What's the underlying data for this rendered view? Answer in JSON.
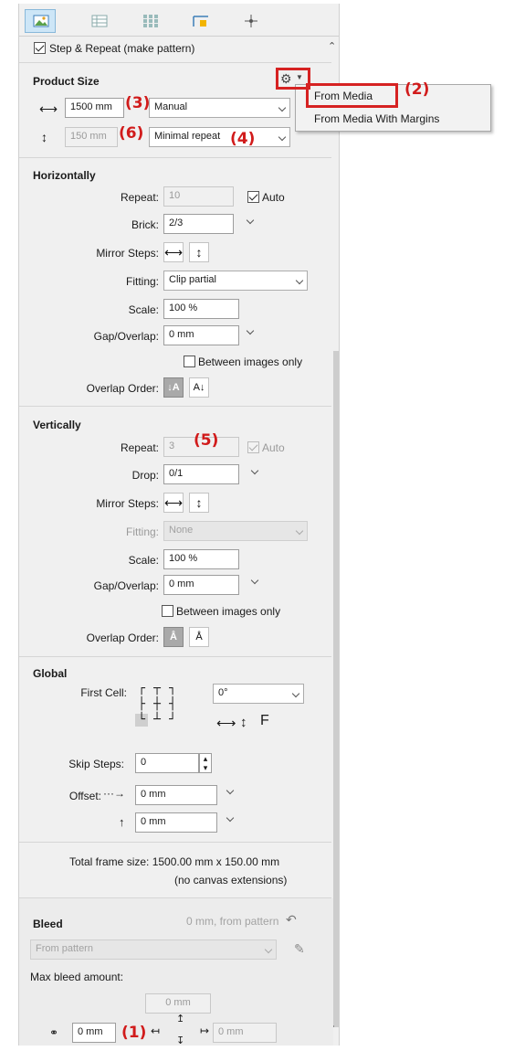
{
  "toolbar": {
    "tabs": [
      {
        "icon": "image-layout-icon",
        "active": true
      },
      {
        "icon": "table-grid-icon",
        "active": false
      },
      {
        "icon": "tile-grid-icon",
        "active": false
      },
      {
        "icon": "step-repeat-icon",
        "active": false
      },
      {
        "icon": "crosshair-icon",
        "active": false
      }
    ]
  },
  "step_repeat": {
    "label": "Step & Repeat (make pattern)",
    "checked": true
  },
  "product_size": {
    "title": "Product Size",
    "width_value": "1500 mm",
    "width_mode": "Manual",
    "height_value": "150 mm",
    "height_mode": "Minimal repeat"
  },
  "menu": {
    "items": [
      "From Media",
      "From Media With Margins"
    ]
  },
  "annotations": [
    "(1)",
    "(2)",
    "(3)",
    "(4)",
    "(5)",
    "(6)"
  ],
  "horizontally": {
    "title": "Horizontally",
    "repeat_label": "Repeat:",
    "repeat_value": "10",
    "auto_label": "Auto",
    "brick_label": "Brick:",
    "brick_value": "2/3",
    "mirror_label": "Mirror Steps:",
    "fitting_label": "Fitting:",
    "fitting_value": "Clip partial",
    "scale_label": "Scale:",
    "scale_value": "100 %",
    "gap_label": "Gap/Overlap:",
    "gap_value": "0 mm",
    "between_label": "Between images only",
    "overlap_label": "Overlap Order:",
    "order_a": "↓A",
    "order_b": "A↓"
  },
  "vertically": {
    "title": "Vertically",
    "repeat_label": "Repeat:",
    "repeat_value": "3",
    "auto_label": "Auto",
    "drop_label": "Drop:",
    "drop_value": "0/1",
    "mirror_label": "Mirror Steps:",
    "fitting_label": "Fitting:",
    "fitting_value": "None",
    "scale_label": "Scale:",
    "scale_value": "100 %",
    "gap_label": "Gap/Overlap:",
    "gap_value": "0 mm",
    "between_label": "Between images only",
    "overlap_label": "Overlap Order:"
  },
  "global": {
    "title": "Global",
    "first_cell_label": "First Cell:",
    "rotation_value": "0°",
    "flip_label": "F",
    "skip_label": "Skip Steps:",
    "skip_value": "0",
    "offset_label": "Offset:",
    "offset_x": "0 mm",
    "offset_y": "0 mm",
    "total_line1": "Total frame size:  1500.00 mm x 150.00 mm",
    "total_line2": "(no canvas extensions)"
  },
  "bleed": {
    "title": "Bleed",
    "summary": "0 mm, from pattern",
    "source": "From pattern",
    "max_label": "Max bleed amount:",
    "max_value": "0 mm",
    "left_value": "0 mm",
    "right_value": "0 mm"
  },
  "colors": {
    "annotation": "#d11b1b",
    "panel_bg": "#f0f0f0"
  }
}
